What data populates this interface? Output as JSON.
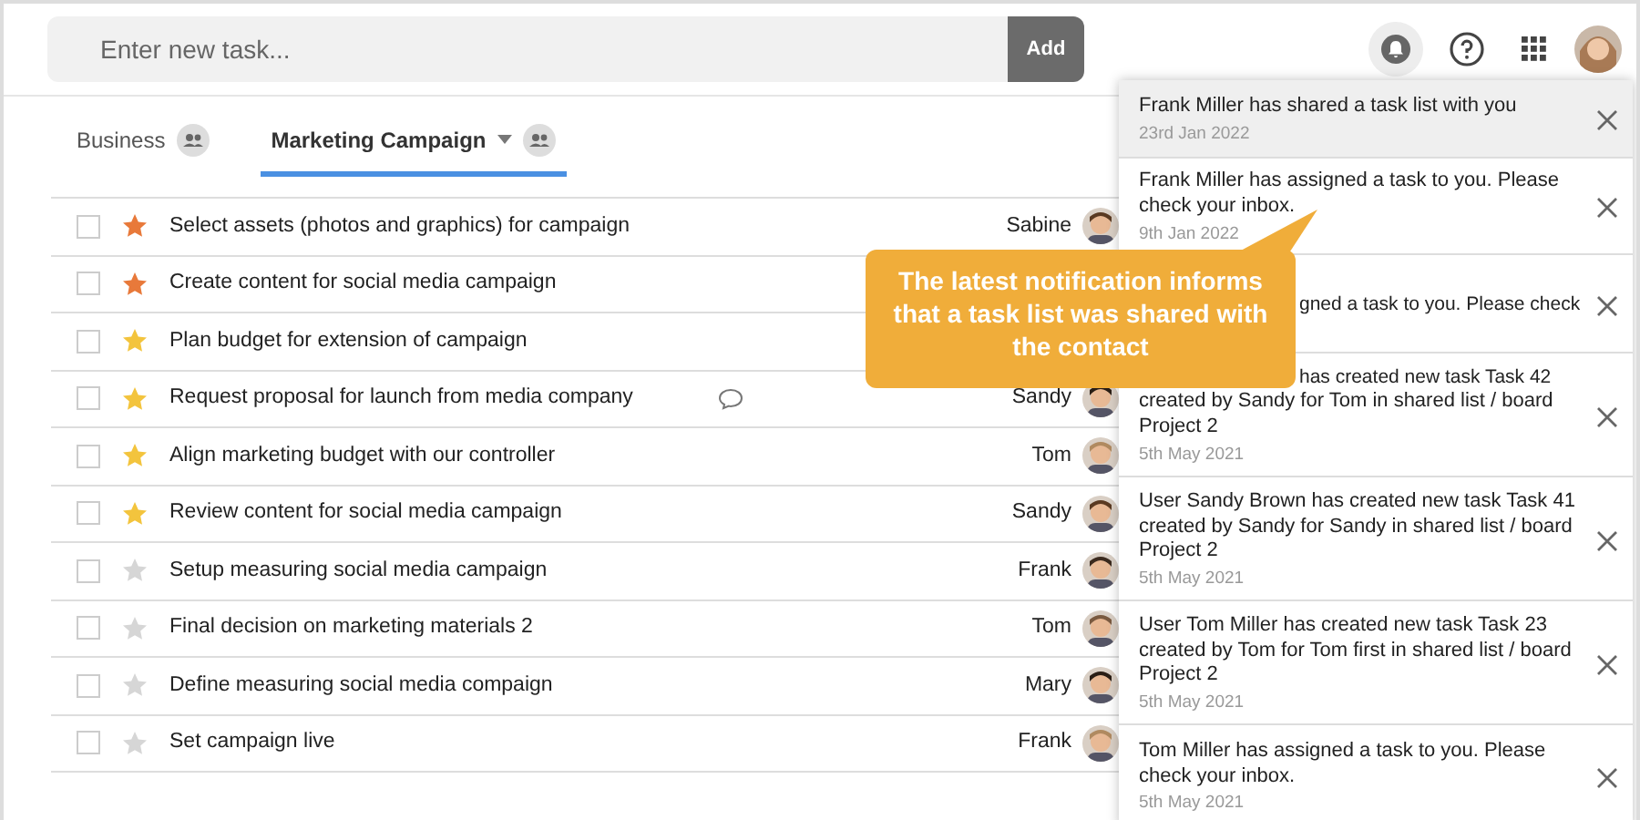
{
  "task_input": {
    "placeholder": "Enter new task...",
    "button": "Add"
  },
  "header_icons": {
    "notifications_active": true
  },
  "tabs": [
    {
      "label": "Business",
      "selected": false
    },
    {
      "label": "Marketing Campaign",
      "selected": true,
      "dropdown": true
    }
  ],
  "tasks": [
    {
      "title": "Select assets (photos and graphics) for campaign",
      "checked": false,
      "color": "#e8793a",
      "assignee": "Sabine"
    },
    {
      "title": "Create content for social media campaign",
      "checked": false,
      "color": "#e8793a"
    },
    {
      "title": "Plan budget for extension of campaign",
      "checked": false,
      "color": "#f3c43d"
    },
    {
      "title": "Request proposal for launch from media company",
      "checked": false,
      "color": "#f3c43d",
      "assignee": "Sandy",
      "comment": true
    },
    {
      "title": "Align marketing budget with our controller",
      "checked": false,
      "color": "#f3c43d",
      "assignee": "Tom"
    },
    {
      "title": "Review content for social media campaign",
      "checked": false,
      "color": "#f3c43d",
      "assignee": "Sandy"
    },
    {
      "title": "Setup measuring social media campaign",
      "checked": false,
      "color": "#d6d6d6",
      "assignee": "Frank"
    },
    {
      "title": "Final decision on marketing materials 2",
      "checked": false,
      "color": "#d6d6d6",
      "assignee": "Tom"
    },
    {
      "title": "Define measuring social media compaign",
      "checked": false,
      "color": "#d6d6d6",
      "assignee": "Mary"
    },
    {
      "title": "Set campaign live",
      "checked": false,
      "color": "#d6d6d6",
      "assignee": "Frank"
    }
  ],
  "notifications": [
    {
      "text": "Frank Miller has shared a task list with you",
      "date": "23rd Jan 2022",
      "selected": true
    },
    {
      "text": "Frank Miller has assigned a task to you. Please check your inbox.",
      "date": "9th Jan 2022",
      "selected": false
    },
    {
      "visible_end": "gned a task to you. Please check",
      "selected": false
    },
    {
      "visible_end": "has created new task Task 42",
      "text": "created by Sandy for Tom in shared list / board Project 2",
      "date": "5th May 2021",
      "selected": false
    },
    {
      "text": "User Sandy Brown has created new task Task 41 created by Sandy for Sandy in shared list / board Project 2",
      "date": "5th May 2021",
      "selected": false
    },
    {
      "text": "User Tom Miller has created new task Task 23 created by Tom for Tom first in shared list / board Project 2",
      "date": "5th May 2021",
      "selected": false
    },
    {
      "text": "Tom Miller has assigned a task to you. Please check your inbox.",
      "date": "5th May 2021",
      "selected": false
    }
  ],
  "callout": {
    "text": "The latest notification informs that a task list was shared with the contact"
  }
}
